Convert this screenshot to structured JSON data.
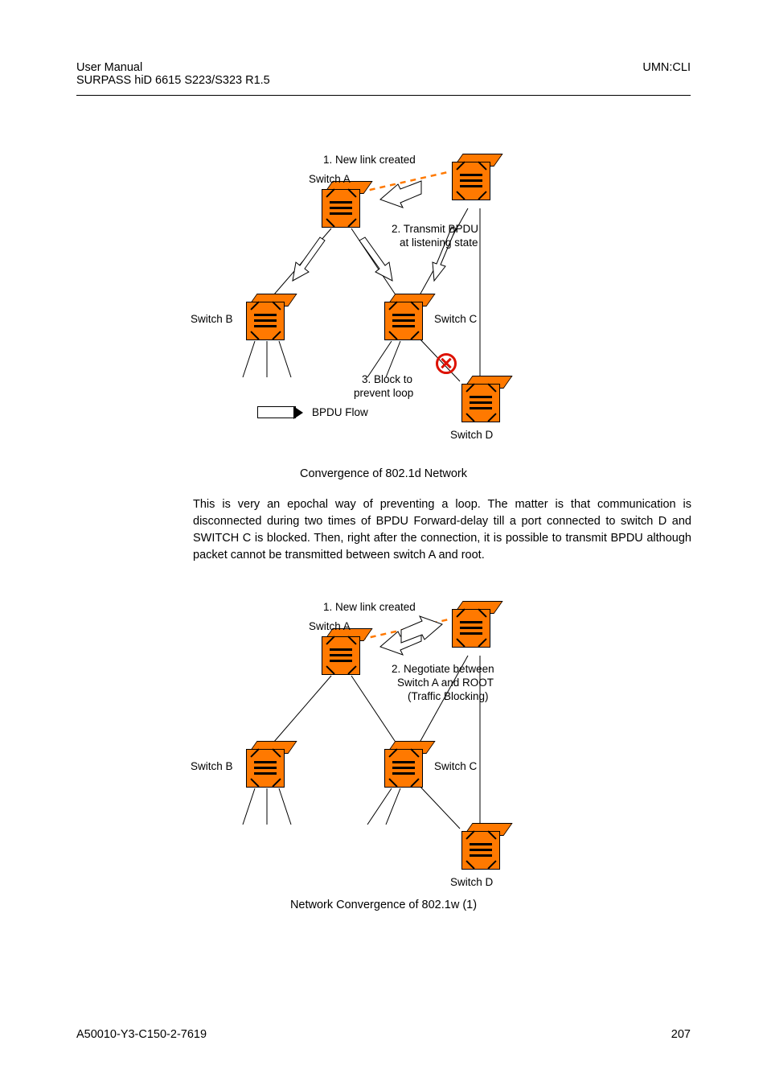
{
  "header": {
    "left1": "User  Manual",
    "left2": "SURPASS hiD 6615 S223/S323 R1.5",
    "right": "UMN:CLI"
  },
  "diagram1": {
    "note1": "1. New link created",
    "note2_line1": "2. Transmit BPDU",
    "note2_line2": "at listening state",
    "note3_line1": "3. Block to",
    "note3_line2": "prevent loop",
    "legend": "BPDU Flow",
    "switchA": "Switch A",
    "switchB": "Switch B",
    "switchC": "Switch C",
    "switchD": "Switch D",
    "caption": "Convergence of 802.1d Network"
  },
  "paragraph": "This is very an epochal way of preventing a loop. The matter is that communication is disconnected during two times of BPDU Forward-delay till a port connected to switch D and SWITCH C is blocked. Then, right after the connection, it is possible to transmit BPDU although packet cannot be transmitted between switch A and root.",
  "diagram2": {
    "note1": "1. New link created",
    "note2_line1": "2. Negotiate between",
    "note2_line2": "Switch A and ROOT",
    "note2_line3": "(Traffic Blocking)",
    "switchA": "Switch A",
    "switchB": "Switch B",
    "switchC": "Switch C",
    "switchD": "Switch D",
    "caption": "Network Convergence of 802.1w (1)"
  },
  "footer": {
    "left": "A50010-Y3-C150-2-7619",
    "right": "207"
  }
}
